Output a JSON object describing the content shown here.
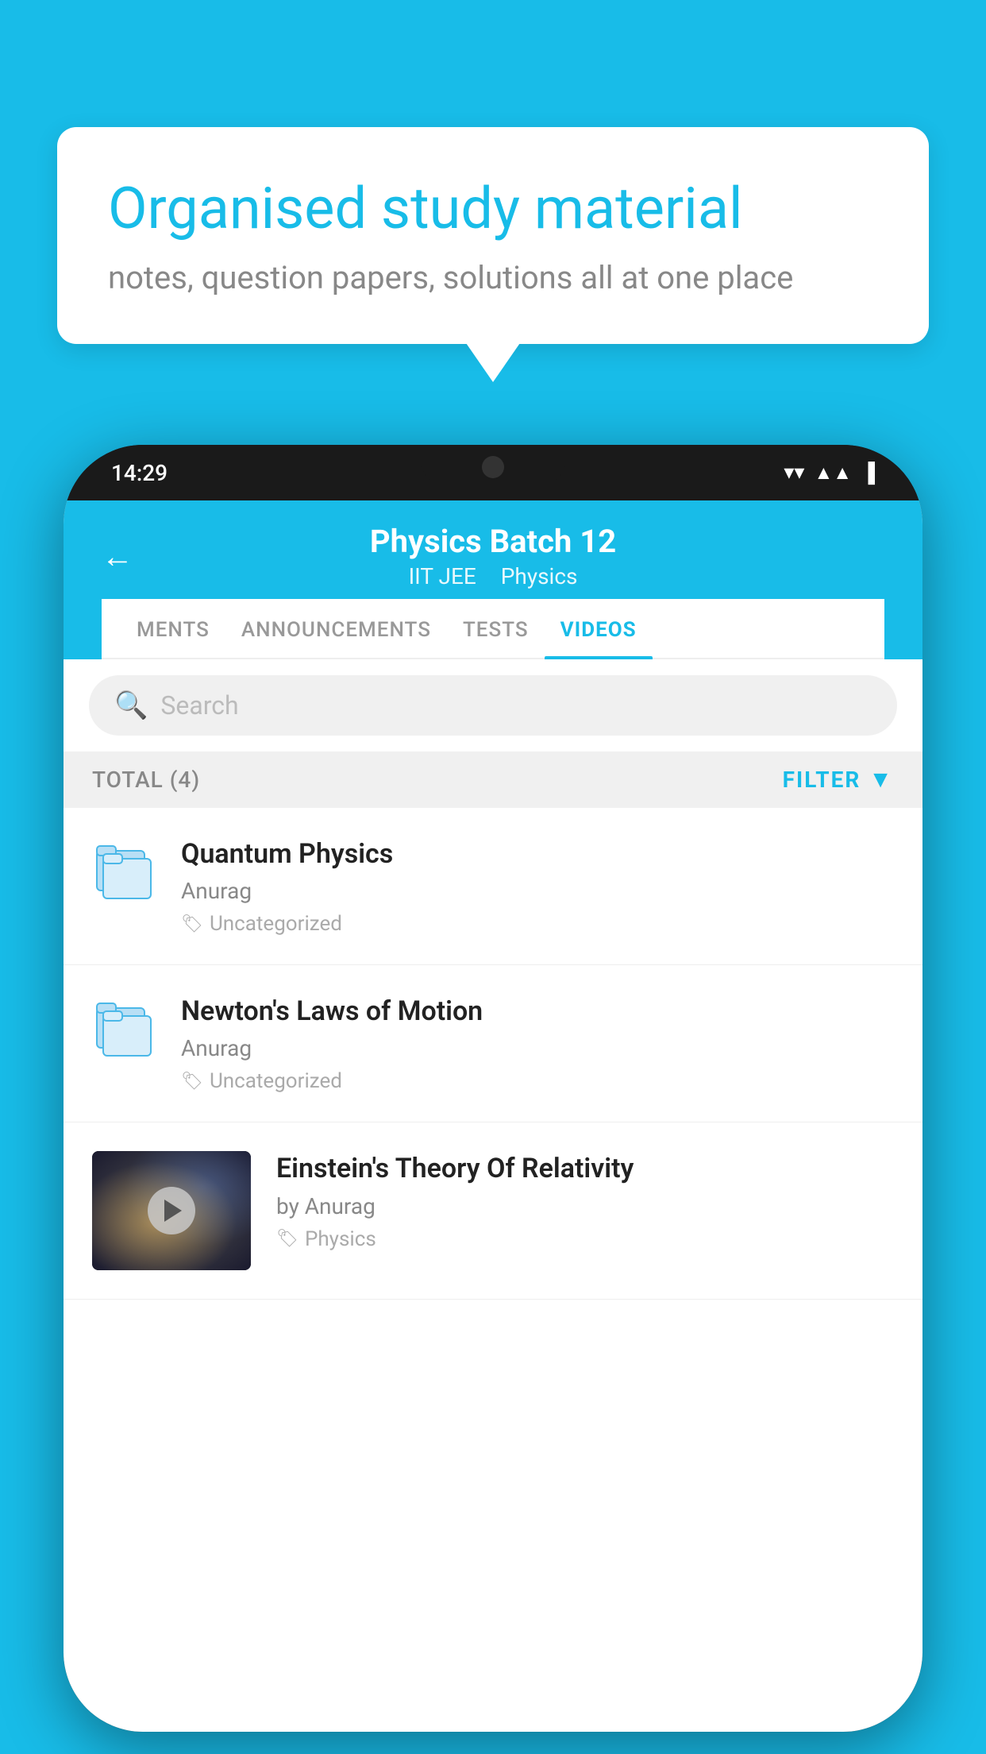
{
  "background_color": "#18bce8",
  "speech_bubble": {
    "title": "Organised study material",
    "subtitle": "notes, question papers, solutions all at one place"
  },
  "phone": {
    "status_bar": {
      "time": "14:29"
    },
    "app_header": {
      "title": "Physics Batch 12",
      "subtitle_part1": "IIT JEE",
      "subtitle_part2": "Physics",
      "back_label": "←"
    },
    "tabs": [
      {
        "label": "MENTS",
        "active": false
      },
      {
        "label": "ANNOUNCEMENTS",
        "active": false
      },
      {
        "label": "TESTS",
        "active": false
      },
      {
        "label": "VIDEOS",
        "active": true
      }
    ],
    "search": {
      "placeholder": "Search"
    },
    "filter": {
      "total_label": "TOTAL (4)",
      "filter_label": "FILTER"
    },
    "videos": [
      {
        "id": "1",
        "title": "Quantum Physics",
        "author": "Anurag",
        "tag": "Uncategorized",
        "has_thumbnail": false
      },
      {
        "id": "2",
        "title": "Newton's Laws of Motion",
        "author": "Anurag",
        "tag": "Uncategorized",
        "has_thumbnail": false
      },
      {
        "id": "3",
        "title": "Einstein's Theory Of Relativity",
        "author": "by Anurag",
        "tag": "Physics",
        "has_thumbnail": true
      }
    ]
  }
}
